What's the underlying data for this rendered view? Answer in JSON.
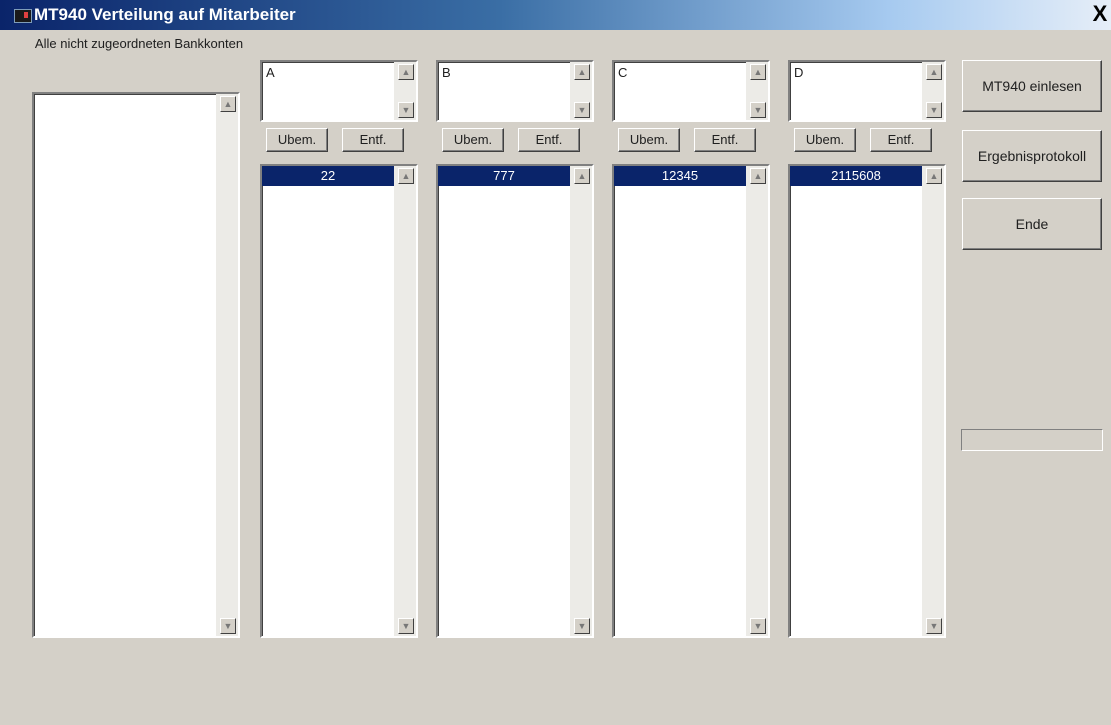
{
  "window": {
    "title": "MT940 Verteilung auf Mitarbeiter",
    "close_label": "X"
  },
  "unassigned": {
    "label": "Alle nicht zugeordneten Bankkonten",
    "items": []
  },
  "columns": [
    {
      "name": "A",
      "assign_label": "Ubem.",
      "remove_label": "Entf.",
      "selected_account": "22"
    },
    {
      "name": "B",
      "assign_label": "Ubem.",
      "remove_label": "Entf.",
      "selected_account": "777"
    },
    {
      "name": "C",
      "assign_label": "Ubem.",
      "remove_label": "Entf.",
      "selected_account": "12345"
    },
    {
      "name": "D",
      "assign_label": "Ubem.",
      "remove_label": "Entf.",
      "selected_account": "2115608"
    }
  ],
  "actions": {
    "read_label": "MT940 einlesen",
    "report_label": "Ergebnisprotokoll",
    "exit_label": "Ende"
  },
  "icons": {
    "scroll_up": "up-arrow-icon",
    "scroll_down": "down-arrow-icon"
  },
  "progress": {
    "value": 0
  },
  "colors": {
    "selection": "#0a246a",
    "dialog_bg": "#d4d0c8"
  }
}
